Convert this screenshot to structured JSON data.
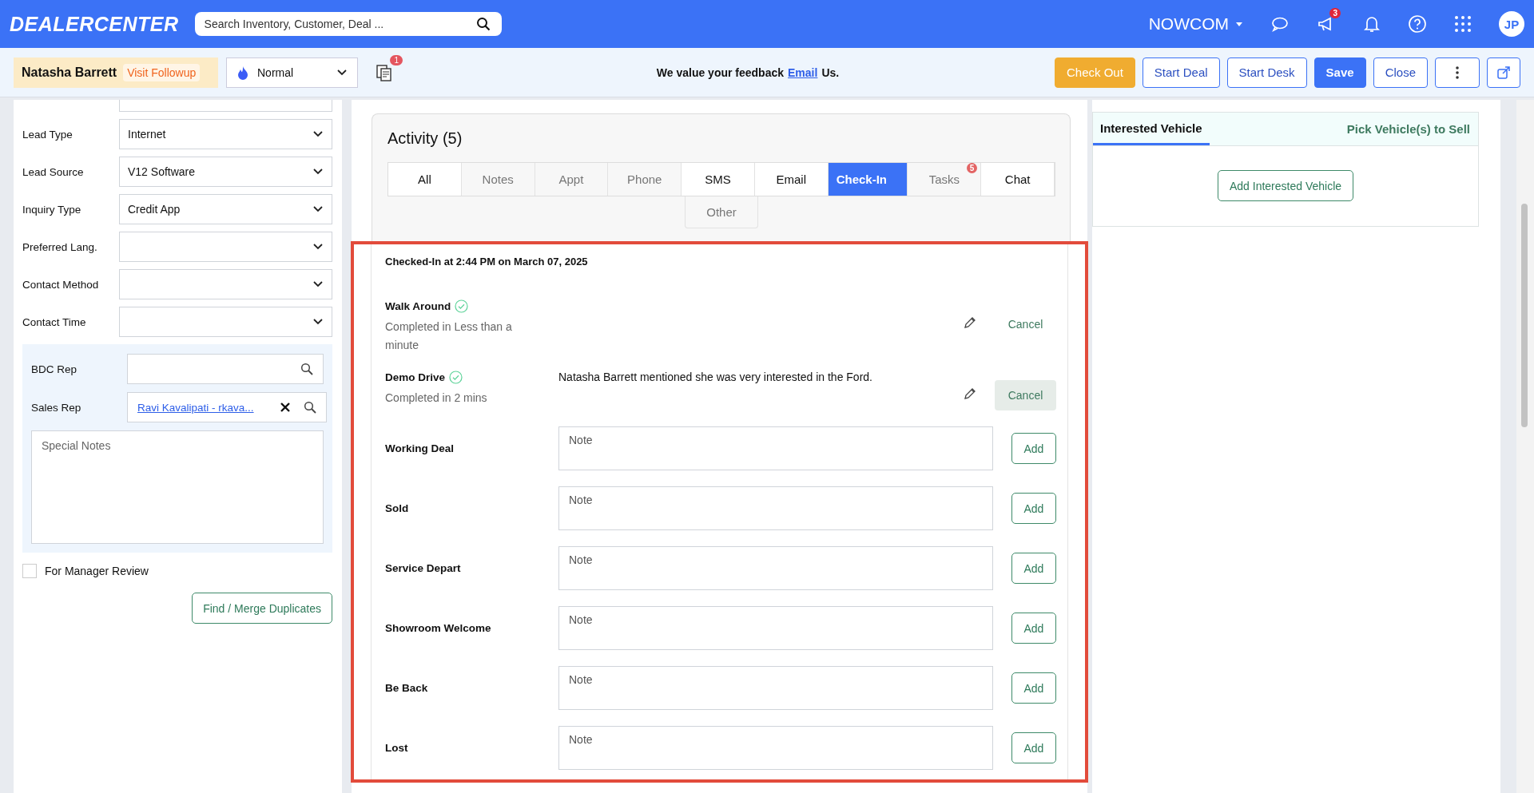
{
  "header": {
    "logo": "DEALERCENTER",
    "search_placeholder": "Search Inventory, Customer, Deal ...",
    "org": "NOWCOM",
    "announcement_count": "3",
    "avatar": "JP"
  },
  "customer": {
    "name": "Natasha Barrett",
    "tag": "Visit Followup",
    "priority": "Normal",
    "doc_count": "1",
    "feedback_before": "We value your feedback",
    "feedback_link": "Email",
    "feedback_after": "Us.",
    "buttons": [
      {
        "label": "Check Out",
        "kind": "warning"
      },
      {
        "label": "Start Deal",
        "kind": "outline"
      },
      {
        "label": "Start Desk",
        "kind": "outline"
      },
      {
        "label": "Save",
        "kind": "primary"
      },
      {
        "label": "Close",
        "kind": "outline"
      }
    ]
  },
  "lead": {
    "fields": [
      {
        "label": "Lead Type",
        "value": "Internet"
      },
      {
        "label": "Lead Source",
        "value": "V12 Software"
      },
      {
        "label": "Inquiry Type",
        "value": "Credit App"
      },
      {
        "label": "Preferred Lang."
      },
      {
        "label": "Contact Method"
      },
      {
        "label": "Contact Time"
      }
    ],
    "reps": [
      {
        "label": "BDC Rep"
      },
      {
        "label": "Sales Rep",
        "value": "Ravi Kavalipati - rkava..."
      }
    ],
    "notes_placeholder": "Special Notes",
    "manager_review": {
      "label": "For Manager Review",
      "checked": false
    },
    "find_button": "Find / Merge Duplicates"
  },
  "activity": {
    "title": "Activity (5)",
    "tabs": [
      {
        "label": "All",
        "selected": false,
        "disabled": false
      },
      {
        "label": "Notes",
        "selected": false,
        "disabled": true
      },
      {
        "label": "Appt",
        "selected": false,
        "disabled": true
      },
      {
        "label": "Phone",
        "selected": false,
        "disabled": true
      },
      {
        "label": "SMS",
        "selected": false,
        "disabled": false
      },
      {
        "label": "Email",
        "selected": false,
        "disabled": false
      },
      {
        "label": "Check-In",
        "selected": true,
        "disabled": false
      },
      {
        "label": "Tasks",
        "selected": false,
        "disabled": true,
        "badge": "5"
      },
      {
        "label": "Chat",
        "selected": false,
        "disabled": false
      },
      {
        "label": "Other",
        "selected": false,
        "disabled": true
      }
    ],
    "checkin_title": "Checked-In at 2:44 PM on March 07, 2025",
    "completed": [
      {
        "name": "Walk Around",
        "done": true,
        "status": "Completed in Less than a minute",
        "cancel": "Cancel",
        "hovered": false
      },
      {
        "name": "Demo Drive",
        "done": true,
        "status": "Completed in 2 mins",
        "note": "Natasha Barrett mentioned she was very interested in the Ford.",
        "cancel": "Cancel",
        "hovered": true
      }
    ],
    "steps": [
      {
        "label": "Working Deal",
        "placeholder": "Note",
        "button": "Add"
      },
      {
        "label": "Sold",
        "placeholder": "Note",
        "button": "Add"
      },
      {
        "label": "Service Depart",
        "placeholder": "Note",
        "button": "Add"
      },
      {
        "label": "Showroom Welcome",
        "placeholder": "Note",
        "button": "Add"
      },
      {
        "label": "Be Back",
        "placeholder": "Note",
        "button": "Add"
      },
      {
        "label": "Lost",
        "placeholder": "Note",
        "button": "Add"
      }
    ]
  },
  "vehicles": {
    "tab": "Interested Vehicle",
    "selected": true,
    "pick_link": "Pick Vehicle(s) to Sell",
    "add_button": "Add Interested Vehicle"
  }
}
